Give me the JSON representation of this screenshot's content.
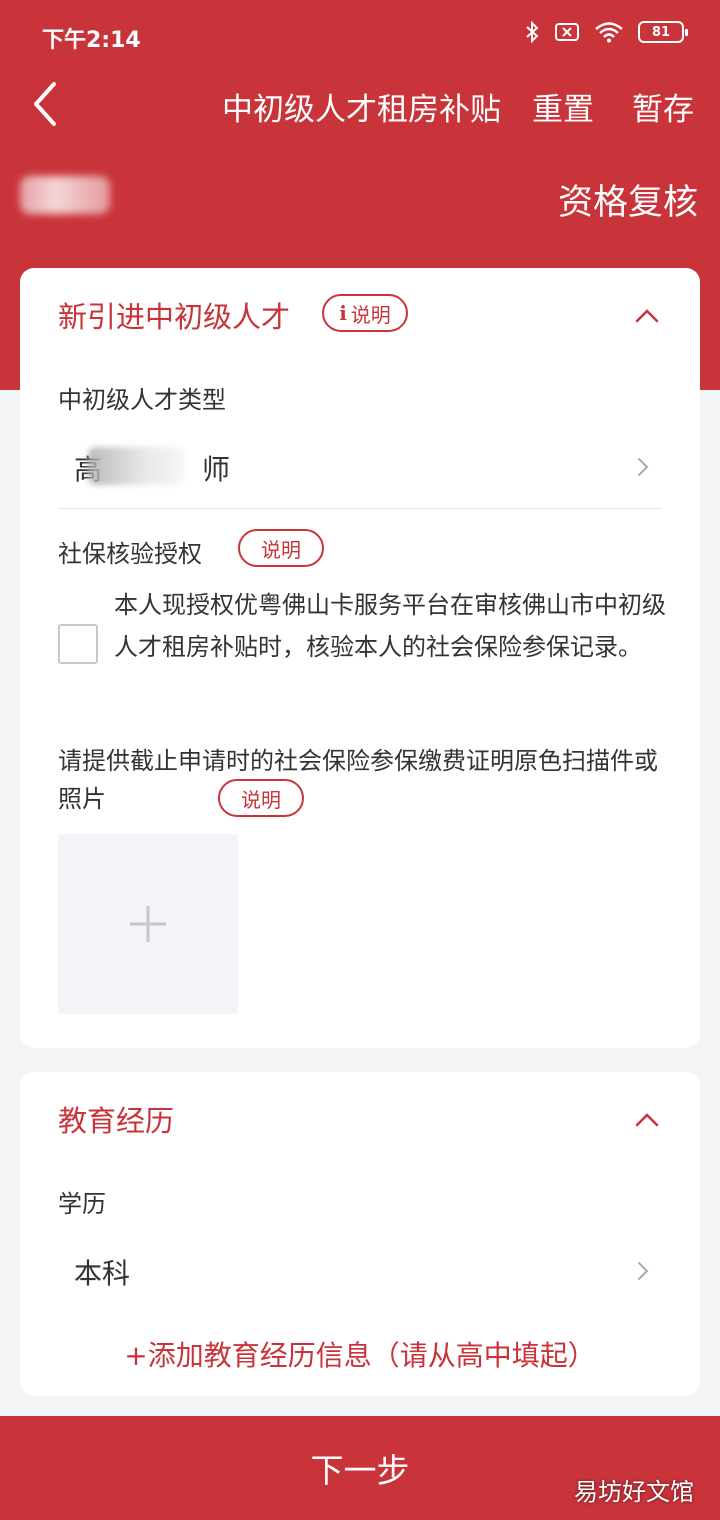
{
  "colors": {
    "accent": "#c9333a",
    "background": "#f3f4f6"
  },
  "status_bar": {
    "time": "下午2:14",
    "battery": "81"
  },
  "nav": {
    "title": "中初级人才租房补贴",
    "reset_label": "重置",
    "save_label": "暂存"
  },
  "sub_header": {
    "step_label": "资格复核"
  },
  "talent_section": {
    "title": "新引进中初级人才",
    "explain_label": "说明",
    "type_label": "中初级人才类型",
    "type_value_start": "高",
    "type_value_end": "师",
    "social_label": "社保核验授权",
    "social_explain": "说明",
    "auth_text": "本人现授权优粤佛山卡服务平台在审核佛山市中初级人才租房补贴时，核验本人的社会保险参保记录。",
    "upload_label": "请提供截止申请时的社会保险参保缴费证明原色扫描件或照片",
    "upload_explain": "说明"
  },
  "education_section": {
    "title": "教育经历",
    "degree_label": "学历",
    "degree_value": "本科",
    "add_label": "+添加教育经历信息（请从高中填起）"
  },
  "footer": {
    "next_label": "下一步",
    "watermark": "易坊好文馆"
  }
}
